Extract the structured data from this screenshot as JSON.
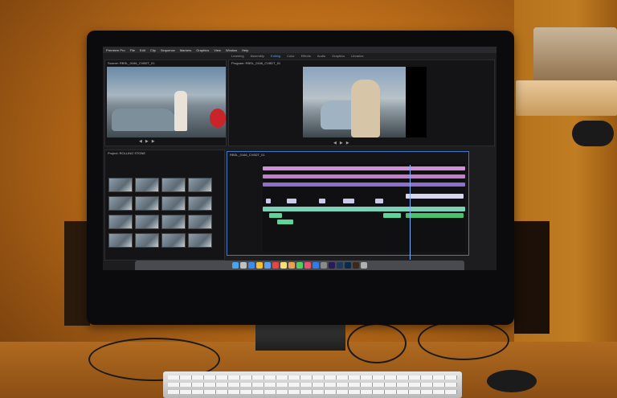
{
  "scene": "video editing workstation",
  "app": {
    "menu": [
      "Premiere Pro",
      "File",
      "Edit",
      "Clip",
      "Sequence",
      "Markers",
      "Graphics",
      "View",
      "Window",
      "Help"
    ],
    "workspace_tabs": [
      "Learning",
      "Assembly",
      "Editing",
      "Color",
      "Effects",
      "Audio",
      "Graphics",
      "Libraries"
    ],
    "active_workspace": "Editing"
  },
  "panels": {
    "source": {
      "title": "Source: RBSL_0166_CV8DT_01"
    },
    "program": {
      "title": "Program: RBSL_0166_CV8DT_01"
    },
    "project": {
      "title": "Project: ROLLING STONE"
    },
    "timeline": {
      "title": "RBSL_0166_CV8DT_01"
    }
  },
  "dock_icons": [
    "finder",
    "launchpad",
    "safari",
    "chrome",
    "mail",
    "calendar",
    "notes",
    "photos",
    "messages",
    "music",
    "app-store",
    "settings",
    "premiere-pro",
    "lightroom",
    "photoshop",
    "bridge",
    "trash"
  ]
}
